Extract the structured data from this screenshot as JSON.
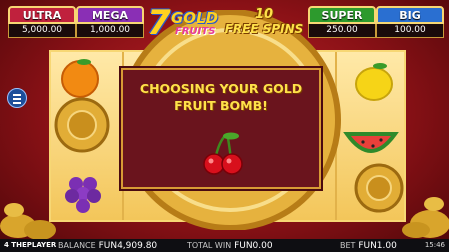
{
  "jackpots": [
    {
      "label": "ULTRA",
      "value": "5,000.00",
      "color": "#c0213d"
    },
    {
      "label": "MEGA",
      "value": "1,000.00",
      "color": "#8a2fb5"
    },
    {
      "label": "SUPER",
      "value": "250.00",
      "color": "#2d9a2d"
    },
    {
      "label": "BIG",
      "value": "100.00",
      "color": "#2a6fd1"
    }
  ],
  "logo": {
    "number": "7",
    "line1": "GOLD",
    "line2": "FRUITS"
  },
  "free_spins": {
    "count": "10",
    "label": "FREE SPINS"
  },
  "panel": {
    "title_line1": "CHOOSING YOUR GOLD",
    "title_line2": "FRUIT BOMB!"
  },
  "bottom_bar": {
    "brand": "4 THEPLAYER",
    "balance_label": "BALANCE",
    "balance_value": "FUN4,909.80",
    "total_win_label": "TOTAL WIN",
    "total_win_value": "FUN0.00",
    "bet_label": "BET",
    "bet_value": "FUN1.00",
    "clock": "15:46"
  },
  "icons": [
    "menu-icon",
    "cherry-icon",
    "orange-icon",
    "lemon-icon",
    "watermelon-icon",
    "grapes-icon",
    "gold-vault-icon"
  ]
}
